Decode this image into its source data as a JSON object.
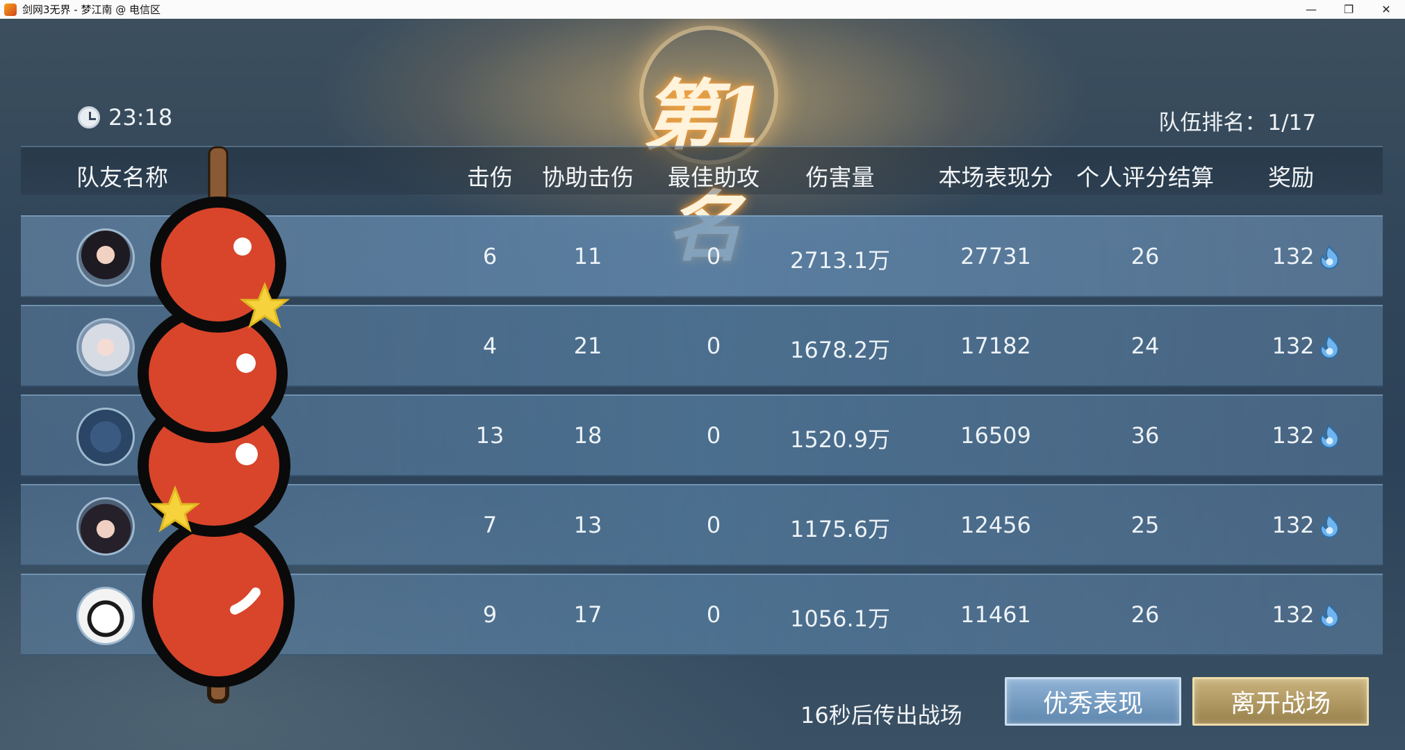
{
  "window": {
    "title": "剑网3无界 - 梦江南 @ 电信区",
    "controls": [
      "minimize",
      "restore",
      "close"
    ]
  },
  "rank": {
    "title": "第1名",
    "timer": "23:18",
    "team_rank_label": "队伍排名：",
    "team_rank_value": "1/17"
  },
  "table": {
    "headers": {
      "name": "队友名称",
      "kills": "击伤",
      "assists": "协助击伤",
      "best_assist": "最佳助攻",
      "damage": "伤害量",
      "performance": "本场表现分",
      "rating": "个人评分结算",
      "reward": "奖励"
    },
    "rows": [
      {
        "kills": "6",
        "assists": "11",
        "best_assist": "0",
        "damage": "2713.1万",
        "performance": "27731",
        "rating": "26",
        "reward": "132",
        "avatar": "dark-hair-character-avatar"
      },
      {
        "kills": "4",
        "assists": "21",
        "best_assist": "0",
        "damage": "1678.2万",
        "performance": "17182",
        "rating": "24",
        "reward": "132",
        "avatar": "white-hair-character-avatar"
      },
      {
        "kills": "13",
        "assists": "18",
        "best_assist": "0",
        "damage": "1520.9万",
        "performance": "16509",
        "rating": "36",
        "reward": "132",
        "avatar": "cloud-emblem-avatar"
      },
      {
        "kills": "7",
        "assists": "13",
        "best_assist": "0",
        "damage": "1175.6万",
        "performance": "12456",
        "rating": "25",
        "reward": "132",
        "avatar": "ornate-hair-character-avatar"
      },
      {
        "kills": "9",
        "assists": "17",
        "best_assist": "0",
        "damage": "1056.1万",
        "performance": "11461",
        "rating": "26",
        "reward": "132",
        "avatar": "panda-avatar"
      }
    ],
    "reward_icon": "blue-flame-currency-icon"
  },
  "footer": {
    "countdown": "16秒后传出战场",
    "excellent_button": "优秀表现",
    "leave_button": "离开战场"
  },
  "overlay": {
    "sticker": "candied-haws-sticker"
  },
  "colors": {
    "row_blue": "#5f82a5",
    "button_blue": "#7aa0c4",
    "button_gold": "#b39a63",
    "glow_gold": "#ffc878",
    "haw_red": "#d8452b"
  }
}
